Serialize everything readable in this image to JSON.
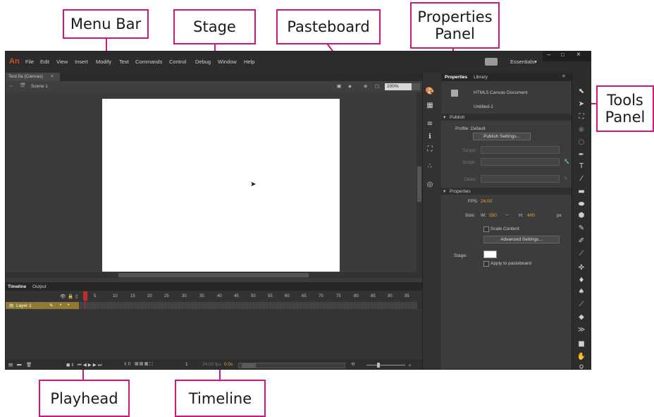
{
  "callouts": {
    "menu_bar": "Menu Bar",
    "stage": "Stage",
    "pasteboard": "Pasteboard",
    "properties_panel_1": "Properties",
    "properties_panel_2": "Panel",
    "tools_panel_1": "Tools",
    "tools_panel_2": "Panel",
    "playhead": "Playhead",
    "timeline": "Timeline"
  },
  "app": {
    "logo": "An",
    "menus": [
      "File",
      "Edit",
      "View",
      "Insert",
      "Modify",
      "Text",
      "Commands",
      "Control",
      "Debug",
      "Window",
      "Help"
    ],
    "workspace": "Essentials",
    "workspace_caret": "▾",
    "win_min": "–",
    "win_max": "□",
    "win_close": "×",
    "doc_tab": "Test.fla (Canvas)",
    "doc_tab_close": "×",
    "scene": "Scene 1",
    "zoom": "100%"
  },
  "properties": {
    "tab_properties": "Properties",
    "tab_library": "Library",
    "doc_type": "HTML5 Canvas Document",
    "doc_name": "Untitled-1",
    "publish_header": "Publish",
    "profile_label": "Profile:",
    "profile_value": "Default",
    "publish_settings_btn": "Publish Settings...",
    "target_label": "Target:",
    "script_label": "Script:",
    "class_label": "Class:",
    "properties_header": "Properties",
    "fps_label": "FPS:",
    "fps_value": "24.00",
    "size_label": "Size:",
    "w_label": "W:",
    "w_value": "550",
    "h_label": "H:",
    "h_value": "400",
    "px": "px",
    "scale_content": "Scale Content",
    "advanced_settings_btn": "Advanced Settings...",
    "stage_label": "Stage:",
    "apply_pasteboard": "Apply to pasteboard"
  },
  "timeline": {
    "tab_timeline": "Timeline",
    "tab_output": "Output",
    "layer_name": "Layer 1",
    "frame_numbers": [
      "1",
      "5",
      "10",
      "15",
      "20",
      "25",
      "30",
      "35",
      "40",
      "45",
      "50",
      "55",
      "60",
      "65",
      "70",
      "75",
      "80",
      "85",
      "90",
      "95"
    ],
    "frame_readout": "1",
    "fps_readout": "24.00 fps",
    "time_readout": "0.0s"
  },
  "colors": {
    "accent_magenta": "#d0157b",
    "layer_highlight": "#8f7a35",
    "fps_orange": "#e8a53a",
    "app_bg": "#3b3b3b"
  },
  "icons": {
    "tools": [
      "selection-tool-icon",
      "subselection-tool-icon",
      "free-transform-icon",
      "3d-rotation-icon",
      "lasso-icon",
      "pen-tool-icon",
      "text-tool-icon",
      "line-tool-icon",
      "rectangle-tool-icon",
      "oval-tool-icon",
      "polystar-tool-icon",
      "pencil-tool-icon",
      "brush-tool-icon",
      "paint-brush-icon",
      "bone-tool-icon",
      "paint-bucket-icon",
      "ink-bottle-icon",
      "eyedropper-icon",
      "eraser-icon",
      "width-tool-icon",
      "camera-tool-icon",
      "hand-tool-icon",
      "zoom-tool-icon"
    ]
  }
}
